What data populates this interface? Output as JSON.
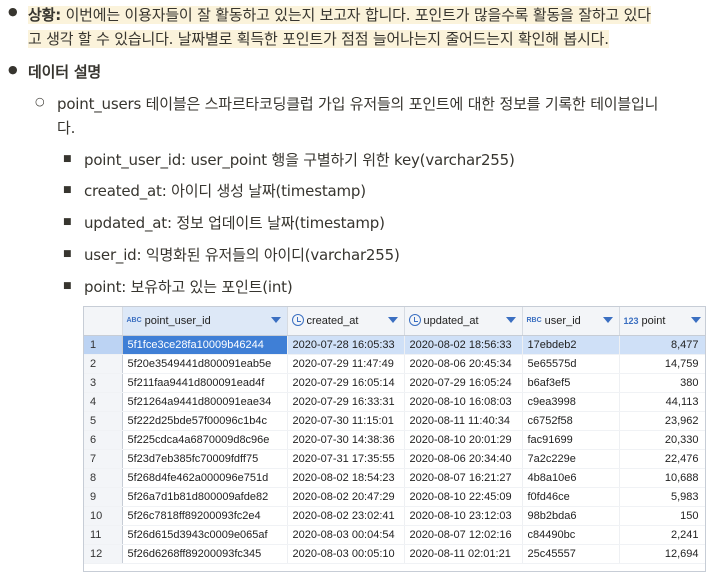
{
  "bullets": {
    "situation_label": "상황:",
    "situation_line1": " 이번에는 이용자들이 잘 활동하고 있는지 보고자 합니다. 포인트가 많을수록 활동을 잘하고 있다",
    "situation_line2": "고 생각 할 수 있습니다. 날짜별로 획득한 포인트가 점점 늘어나는지 줄어드는지 확인해 봅시다.",
    "data_desc_label": "데이터 설명",
    "table_desc_line1": "point_users 테이블은 스파르타코딩클럽 가입 유저들의 포인트에 대한 정보를 기록한 테이블입니",
    "table_desc_line2": "다.",
    "columns": [
      "point_user_id: user_point 행을 구별하기 위한 key(varchar255)",
      "created_at: 아이디 생성 날짜(timestamp)",
      "updated_at: 정보 업데이트 날짜(timestamp)",
      "user_id: 익명화된 유저들의 아이디(varchar255)",
      "point: 보유하고 있는 포인트(int)"
    ]
  },
  "icons": {
    "text_type": "ABC",
    "text_type_alt": "RBC",
    "int_type": "123",
    "clock": "clock-icon",
    "sort": "chevron-down-icon",
    "bullet_filled": "●",
    "bullet_hollow": "○",
    "bullet_square": "■"
  },
  "grid": {
    "headers": [
      "point_user_id",
      "created_at",
      "updated_at",
      "user_id",
      "point"
    ],
    "rows": [
      [
        "1",
        "5f1fce3ce28fa10009b46244",
        "2020-07-28 16:05:33",
        "2020-08-02 18:56:33",
        "17ebdeb2",
        "8,477"
      ],
      [
        "2",
        "5f20e3549441d800091eab5e",
        "2020-07-29 11:47:49",
        "2020-08-06 20:45:34",
        "5e65575d",
        "14,759"
      ],
      [
        "3",
        "5f211faa9441d800091ead4f",
        "2020-07-29 16:05:14",
        "2020-07-29 16:05:24",
        "b6af3ef5",
        "380"
      ],
      [
        "4",
        "5f21264a9441d800091eae34",
        "2020-07-29 16:33:31",
        "2020-08-10 16:08:03",
        "c9ea3998",
        "44,113"
      ],
      [
        "5",
        "5f222d25bde57f00096c1b4c",
        "2020-07-30 11:15:01",
        "2020-08-11 11:40:34",
        "c6752f58",
        "23,962"
      ],
      [
        "6",
        "5f225cdca4a6870009d8c96e",
        "2020-07-30 14:38:36",
        "2020-08-10 20:01:29",
        "fac91699",
        "20,330"
      ],
      [
        "7",
        "5f23d7eb385fc70009fdff75",
        "2020-07-31 17:35:55",
        "2020-08-06 20:34:40",
        "7a2c229e",
        "22,476"
      ],
      [
        "8",
        "5f268d4fe462a000096e751d",
        "2020-08-02 18:54:23",
        "2020-08-07 16:21:27",
        "4b8a10e6",
        "10,688"
      ],
      [
        "9",
        "5f26a7d1b81d800009afde82",
        "2020-08-02 20:47:29",
        "2020-08-10 22:45:09",
        "f0fd46ce",
        "5,983"
      ],
      [
        "10",
        "5f26c7818ff89200093fc2e4",
        "2020-08-02 23:02:41",
        "2020-08-10 23:12:03",
        "98b2bda6",
        "150"
      ],
      [
        "11",
        "5f26d615d3943c0009e065af",
        "2020-08-03 00:04:54",
        "2020-08-07 12:02:16",
        "c84490bc",
        "2,241"
      ],
      [
        "12",
        "5f26d6268ff89200093fc345",
        "2020-08-03 00:05:10",
        "2020-08-11 02:01:21",
        "25c45557",
        "12,694"
      ]
    ]
  }
}
